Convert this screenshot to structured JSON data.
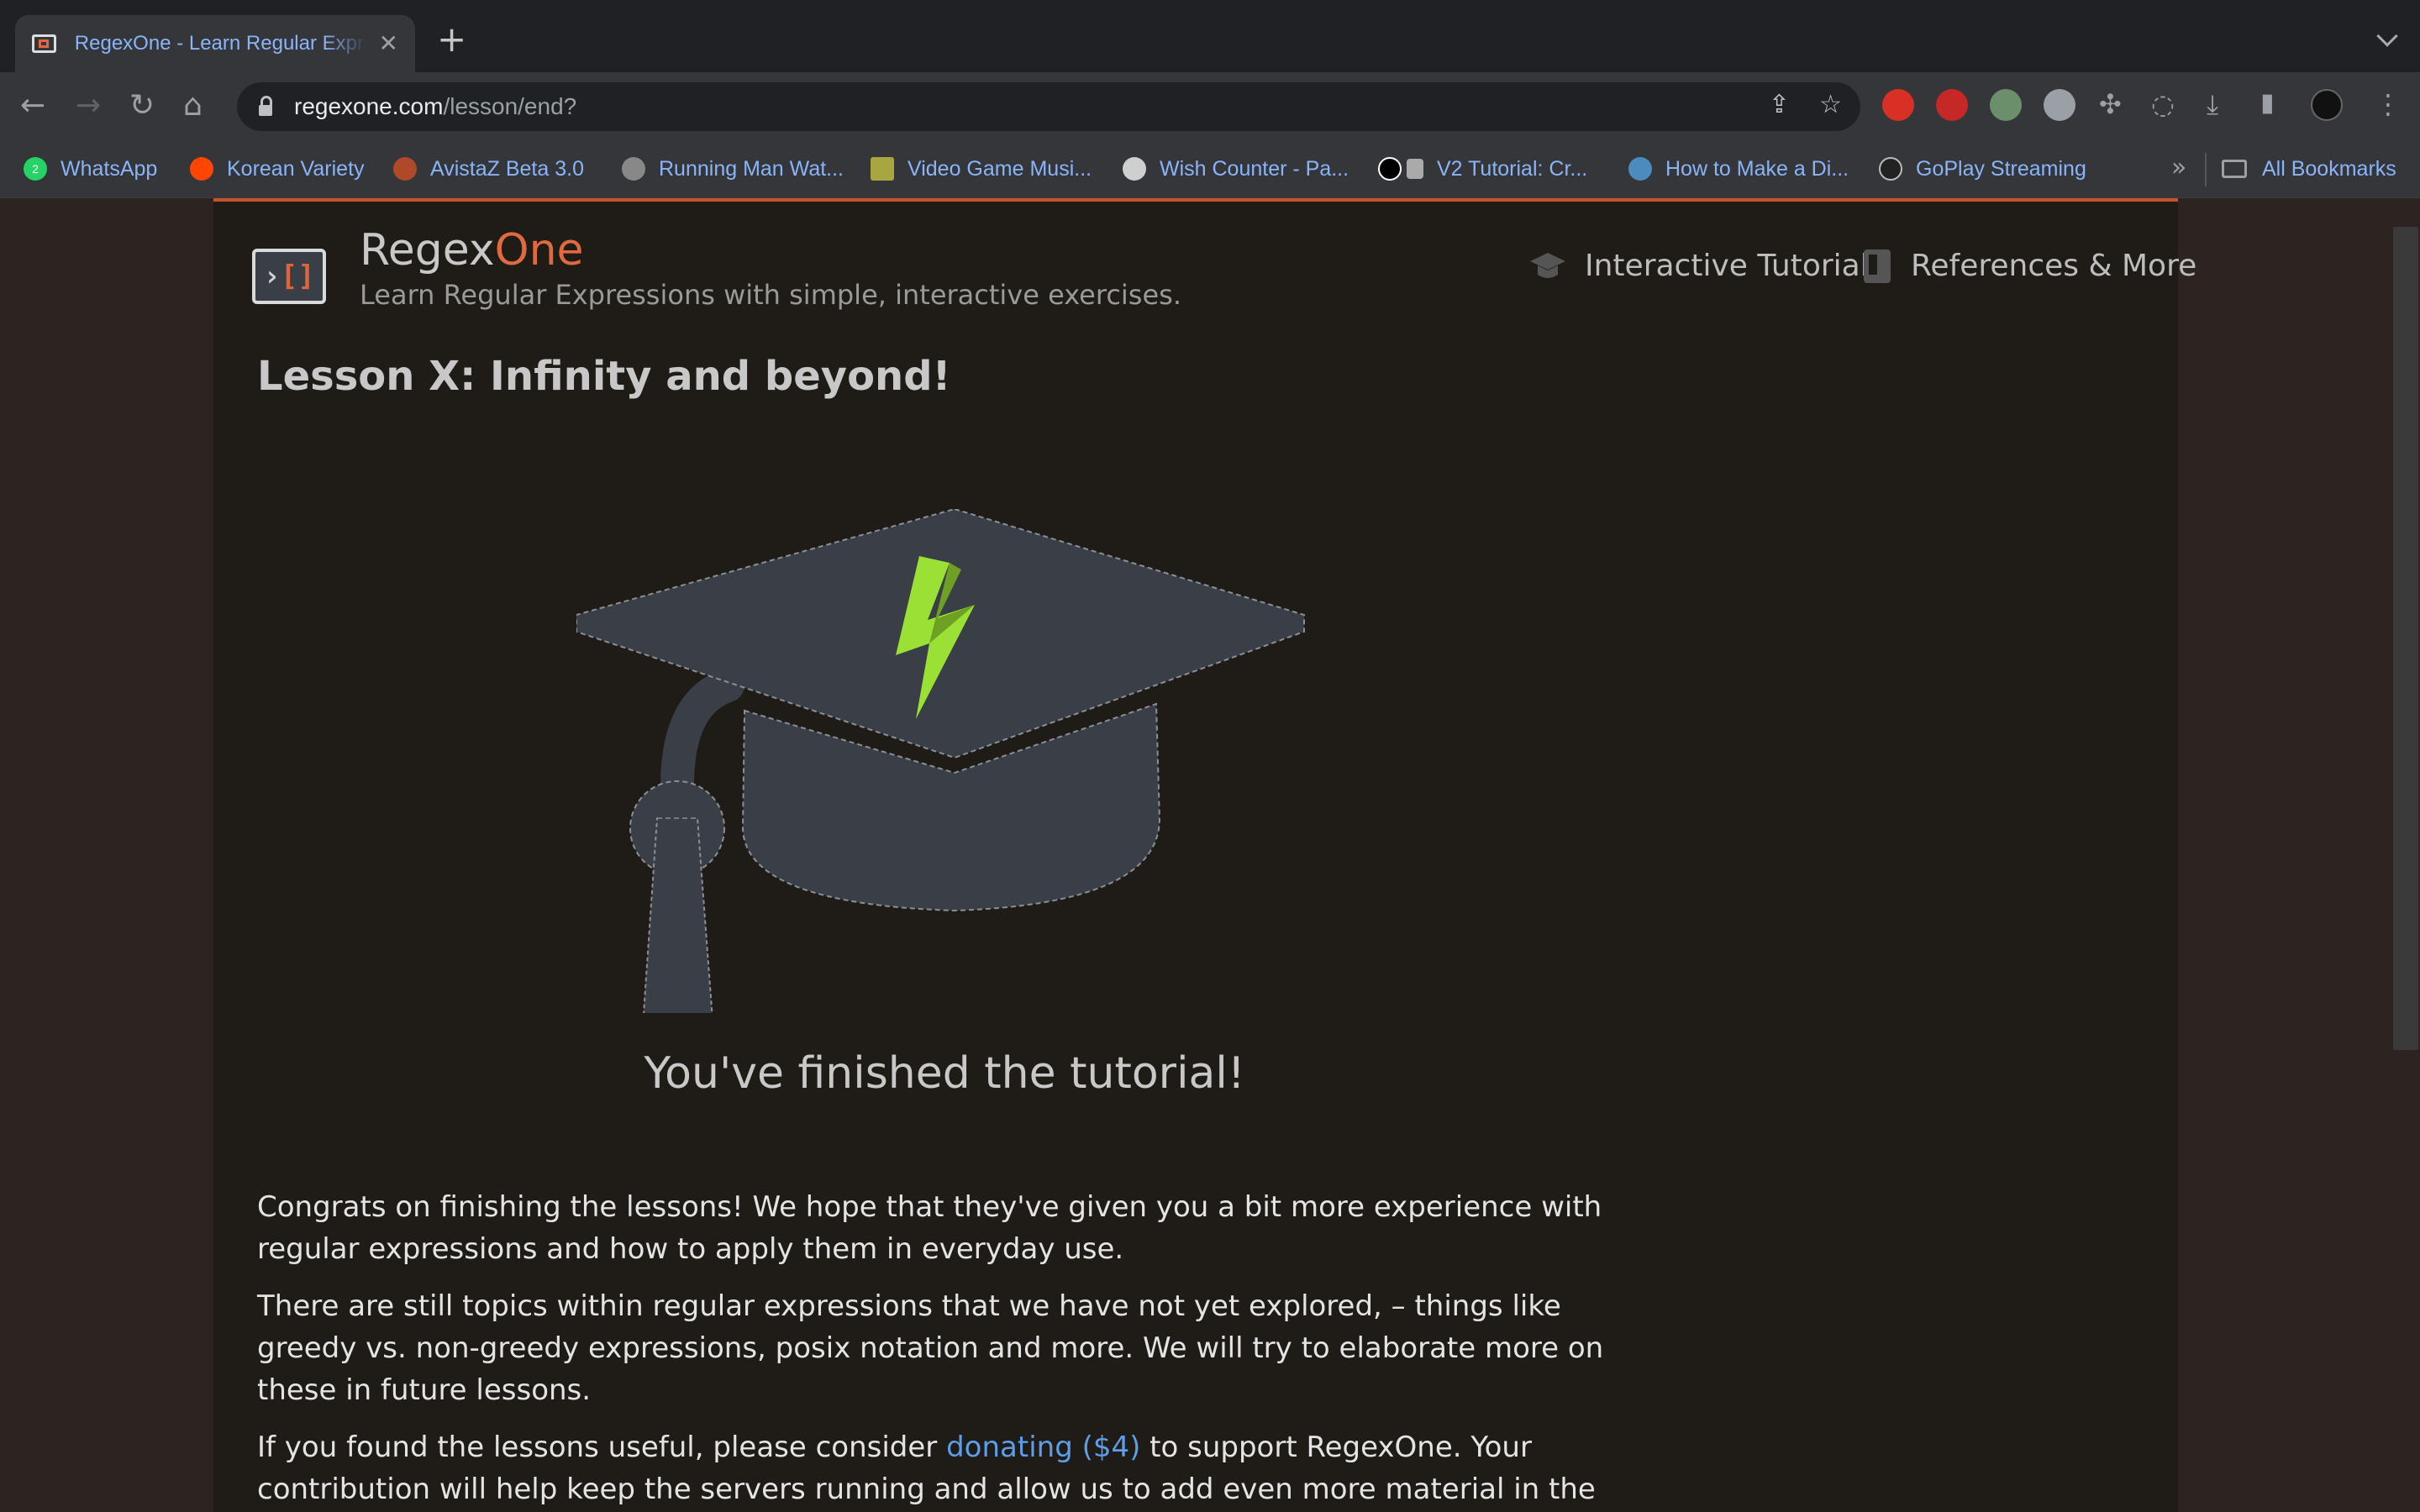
{
  "browser": {
    "tab": {
      "title": "RegexOne - Learn Regular Expressions with simple, interactive exercises."
    },
    "address": {
      "host": "regexone.com",
      "path": "/lesson/end?"
    },
    "bookmarks": [
      {
        "label": "WhatsApp",
        "icon": "whatsapp-icon",
        "color": "#25d366",
        "badge": "2"
      },
      {
        "label": "Korean Variety",
        "icon": "reddit-icon",
        "color": "#ff4500",
        "badge": ""
      },
      {
        "label": "AvistaZ Beta 3.0",
        "icon": "avistaz-icon",
        "color": "#b0482a",
        "badge": ""
      },
      {
        "label": "Running Man Wat...",
        "icon": "globe-icon",
        "color": "#888888",
        "badge": ""
      },
      {
        "label": "Video Game Musi...",
        "icon": "vgm-icon",
        "color": "#a7a640",
        "badge": ""
      },
      {
        "label": "Wish Counter - Pa...",
        "icon": "paimon-icon",
        "color": "#cfcfcf",
        "badge": ""
      },
      {
        "label": "V2 Tutorial: Cr...",
        "icon": "medium-icon",
        "color": "#000000",
        "badge": ""
      },
      {
        "label": "How to Make a Di...",
        "icon": "python-icon",
        "color": "#4b8bbe",
        "badge": ""
      },
      {
        "label": "GoPlay Streaming",
        "icon": "goplay-icon",
        "color": "#222222",
        "badge": ""
      }
    ],
    "all_bookmarks": "All Bookmarks"
  },
  "site": {
    "brand_main": "Regex",
    "brand_accent": "One",
    "tagline": "Learn Regular Expressions with simple, interactive exercises.",
    "nav": {
      "tutorial": "Interactive Tutorial",
      "references": "References & More"
    },
    "accent_color": "#e06a40"
  },
  "content": {
    "lesson_title": "Lesson X: Infinity and beyond!",
    "finished": "You've finished the tutorial!",
    "para1": "Congrats on finishing the lessons! We hope that they've given you a bit more experience with regular expressions and how to apply them in everyday use.",
    "para2": "There are still topics within regular expressions that we have not yet explored, – things like greedy vs. non-greedy expressions, posix notation and more. We will try to elaborate more on these in future lessons.",
    "para3_before": "If you found the lessons useful, please consider ",
    "para3_link": "donating ($4)",
    "para3_after": " to support RegexOne. Your contribution will help keep the servers running and allow us to add even more material in the future. If you have"
  }
}
